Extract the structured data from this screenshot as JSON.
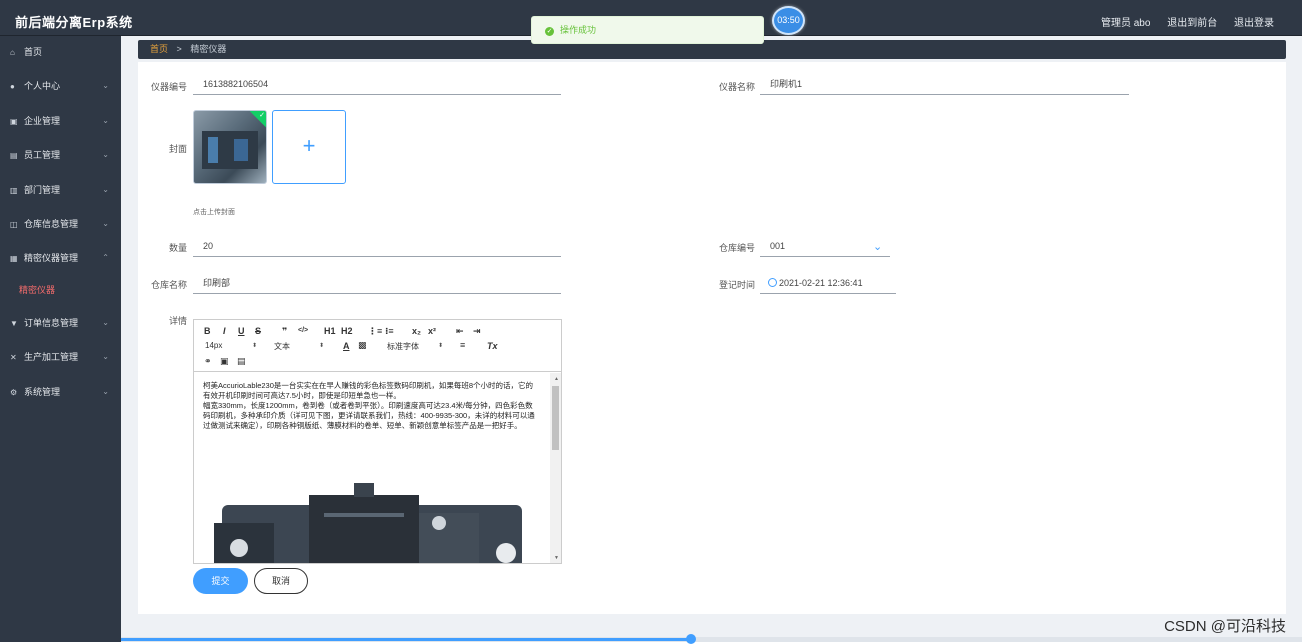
{
  "header": {
    "app_title": "前后端分离Erp系统",
    "timer": "03:50",
    "user": "管理员 abo",
    "back_to_front": "退出到前台",
    "logout": "退出登录"
  },
  "toast": {
    "message": "操作成功"
  },
  "sidebar": {
    "items": [
      {
        "label": "首页",
        "icon": "home-icon",
        "glyph": "⌂"
      },
      {
        "label": "个人中心",
        "icon": "user-icon",
        "glyph": "●"
      },
      {
        "label": "企业管理",
        "icon": "building-icon",
        "glyph": "▣"
      },
      {
        "label": "员工管理",
        "icon": "id-card-icon",
        "glyph": "▤"
      },
      {
        "label": "部门管理",
        "icon": "bar-chart-icon",
        "glyph": "▥"
      },
      {
        "label": "仓库信息管理",
        "icon": "copy-icon",
        "glyph": "◫"
      },
      {
        "label": "精密仪器管理",
        "icon": "instrument-icon",
        "glyph": "▦"
      }
    ],
    "sub_item": "精密仪器",
    "items_after": [
      {
        "label": "订单信息管理",
        "icon": "order-icon",
        "glyph": "▼"
      },
      {
        "label": "生产加工管理",
        "icon": "factory-icon",
        "glyph": "✕"
      },
      {
        "label": "系统管理",
        "icon": "settings-icon",
        "glyph": "⚙"
      }
    ]
  },
  "breadcrumb": {
    "home": "首页",
    "separator": ">",
    "current": "精密仪器"
  },
  "form": {
    "instrument_no_label": "仪器编号",
    "instrument_no": "1613882106504",
    "instrument_name_label": "仪器名称",
    "instrument_name": "印刷机1",
    "cover_label": "封面",
    "upload_hint": "点击上传封面",
    "quantity_label": "数量",
    "quantity": "20",
    "warehouse_no_label": "仓库编号",
    "warehouse_no": "001",
    "warehouse_name_label": "仓库名称",
    "warehouse_name": "印刷部",
    "register_time_label": "登记时间",
    "register_time": "2021-02-21 12:36:41",
    "detail_label": "详情"
  },
  "editor": {
    "toolbar": {
      "bold": "B",
      "italic": "I",
      "underline": "U",
      "strike": "S",
      "quote": "❞",
      "code": "</>",
      "h1": "H1",
      "h2": "H2",
      "ordered_list": "⋮≡",
      "bullet_list": "⁝≡",
      "subscript": "x₂",
      "superscript": "x²",
      "indent_out": "⇤",
      "indent_in": "⇥",
      "font_size": "14px",
      "text_type": "文本",
      "font_family": "标准字体",
      "color": "A",
      "clear": "Tx"
    },
    "paragraph1": "柯美AccurioLable230是一台实实在在早人赚钱的彩色标签数码印刷机，如果每班8个小时的话，它的有效开机印刷时间可高达7.5小时，即使是印短单急也一样。",
    "paragraph2": "幅宽330mm，长度1200mm，卷到卷（或者卷到平张）。印刷速度高可达23.4米/每分钟，四色彩色数码印刷机，多种承印介质（详可见下图，更详请联系我们，热线：400-9935-300，未详的材料可以通过做测试来确定），印刷各种铜版纸、薄膜材料的卷单、短单、新颖创意单标签产品是一把好手。"
  },
  "buttons": {
    "submit": "提交",
    "cancel": "取消"
  },
  "watermark": "CSDN @可沿科技",
  "colors": {
    "sidebar_bg": "#2f3845",
    "primary": "#409eff",
    "active_sub": "#f56c6c",
    "success": "#67c23a"
  }
}
